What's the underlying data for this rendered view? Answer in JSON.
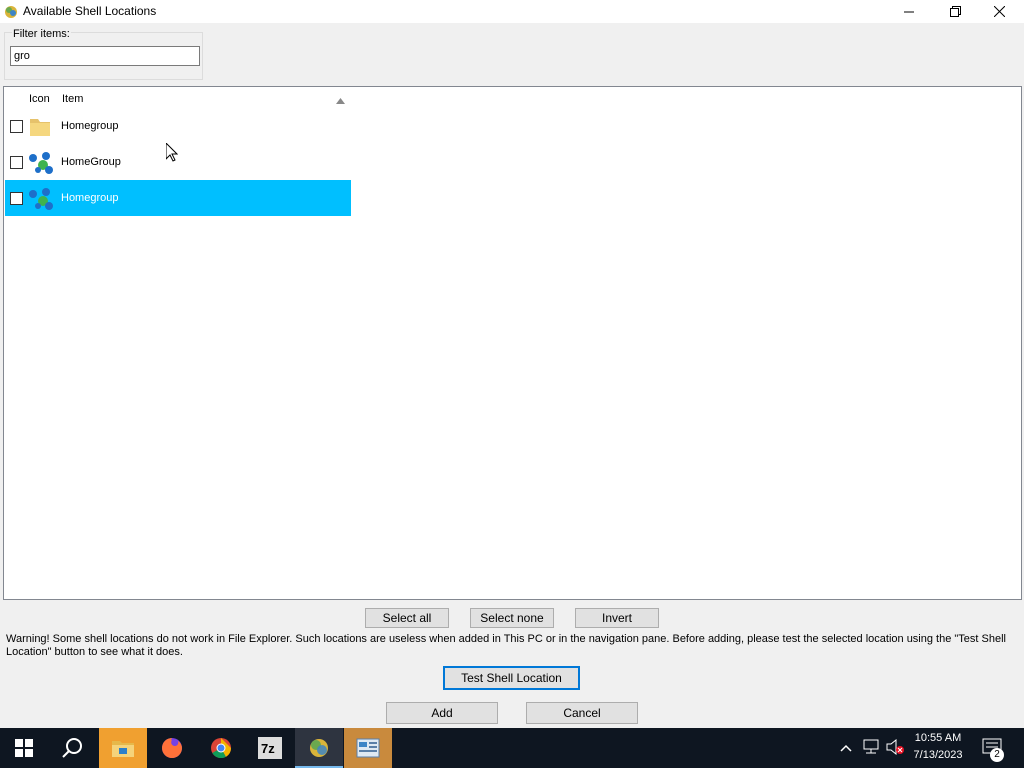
{
  "window": {
    "title": "Available Shell Locations"
  },
  "filter": {
    "label": "Filter items:",
    "value": "gro"
  },
  "list": {
    "columns": {
      "icon": "Icon",
      "item": "Item"
    },
    "rows": [
      {
        "label": "Homegroup",
        "icon": "folder-icon",
        "checked": false,
        "selected": false
      },
      {
        "label": "HomeGroup",
        "icon": "homegroup-icon",
        "checked": false,
        "selected": false
      },
      {
        "label": "Homegroup",
        "icon": "homegroup-icon",
        "checked": false,
        "selected": true
      }
    ]
  },
  "selection_buttons": {
    "select_all": "Select all",
    "select_none": "Select none",
    "invert": "Invert"
  },
  "warning": "Warning! Some shell locations do not work in File Explorer. Such locations are useless when added in This PC or in the navigation pane. Before adding, please test the selected location using the \"Test Shell Location\" button to see what it does.",
  "actions": {
    "test": "Test Shell Location",
    "add": "Add",
    "cancel": "Cancel"
  },
  "taskbar": {
    "clock_time": "10:55 AM",
    "clock_date": "7/13/2023",
    "notification_count": "2",
    "apps": [
      "file-explorer",
      "firefox",
      "chrome",
      "7-zip",
      "winaero-tweaker",
      "control-panel"
    ]
  },
  "colors": {
    "selection": "#00bfff",
    "taskbar": "#0e1621",
    "accent": "#0078d7"
  }
}
